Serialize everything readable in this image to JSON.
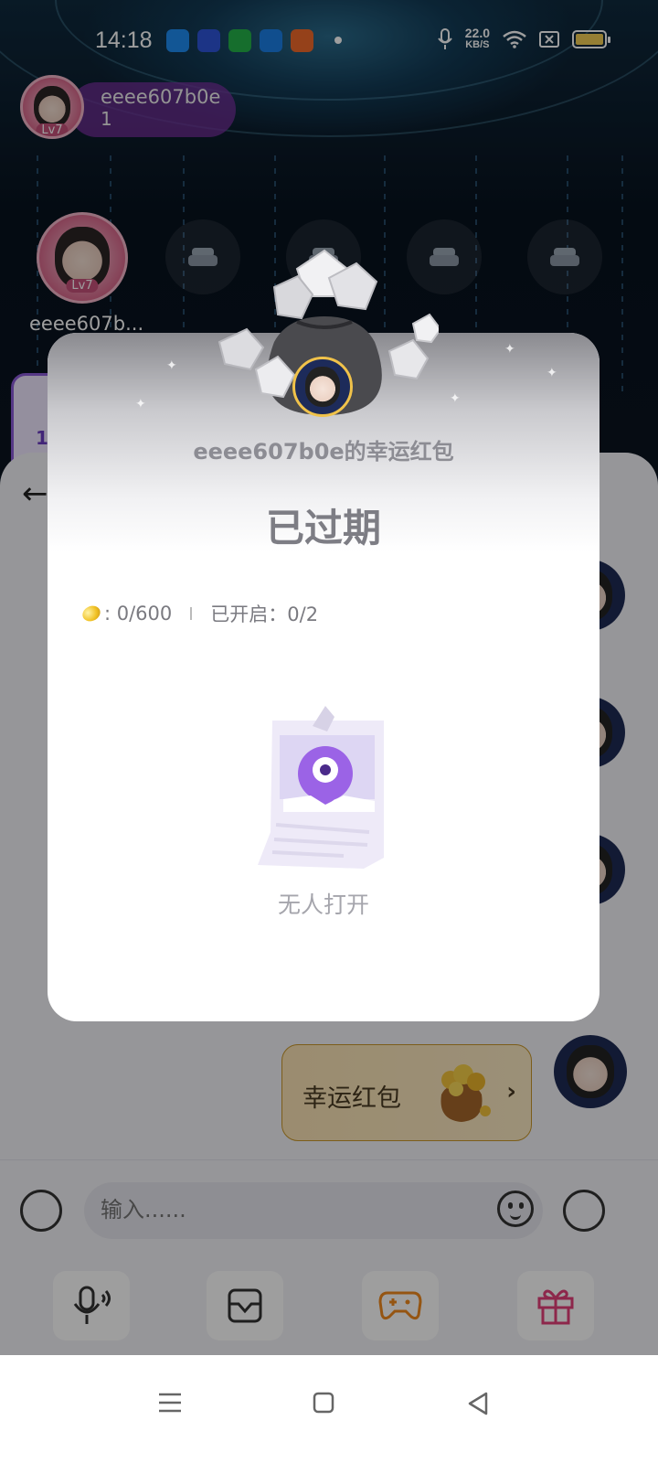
{
  "status_bar": {
    "time": "14:18",
    "net_speed_value": "22.0",
    "net_speed_unit": "KB/S",
    "icons": [
      "baidu-icon",
      "video-icon",
      "shield-icon",
      "browser-icon",
      "game-icon"
    ],
    "battery_color": "#f2cd55"
  },
  "room": {
    "host_name": "eeee607b0e",
    "host_count": "1",
    "host_level": "Lv7",
    "mic_name": "eeee607b...",
    "left_card_count": "1"
  },
  "dialog": {
    "title": "eeee607b0e的幸运红包",
    "status": "已过期",
    "coins_text": ": 0/600",
    "opened_text": "已开启：0/2",
    "empty_text": "无人打开"
  },
  "chat": {
    "red_packet_label": "幸运红包",
    "input_placeholder": "输入......"
  },
  "colors": {
    "accent_purple": "#8c5bd8",
    "red_packet_bg": "#fbe3b4",
    "game_orange": "#f08a1e",
    "gift_pink": "#e4407a"
  }
}
